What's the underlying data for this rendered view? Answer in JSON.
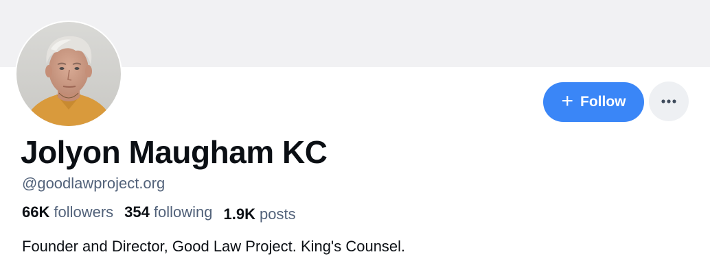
{
  "profile": {
    "display_name": "Jolyon Maugham KC",
    "handle": "@goodlawproject.org",
    "bio": "Founder and Director, Good Law Project. King's Counsel.",
    "avatar_icon": "avatar-photo"
  },
  "stats": {
    "followers_count": "66K",
    "followers_label": "followers",
    "following_count": "354",
    "following_label": "following",
    "posts_count": "1.9K",
    "posts_label": "posts"
  },
  "actions": {
    "follow_label": "Follow",
    "follow_icon": "plus-icon",
    "more_icon": "ellipsis-icon"
  },
  "colors": {
    "accent": "#3a86f7",
    "banner": "#f1f1f3",
    "muted_text": "#52627a",
    "more_button_bg": "#eef0f3"
  }
}
